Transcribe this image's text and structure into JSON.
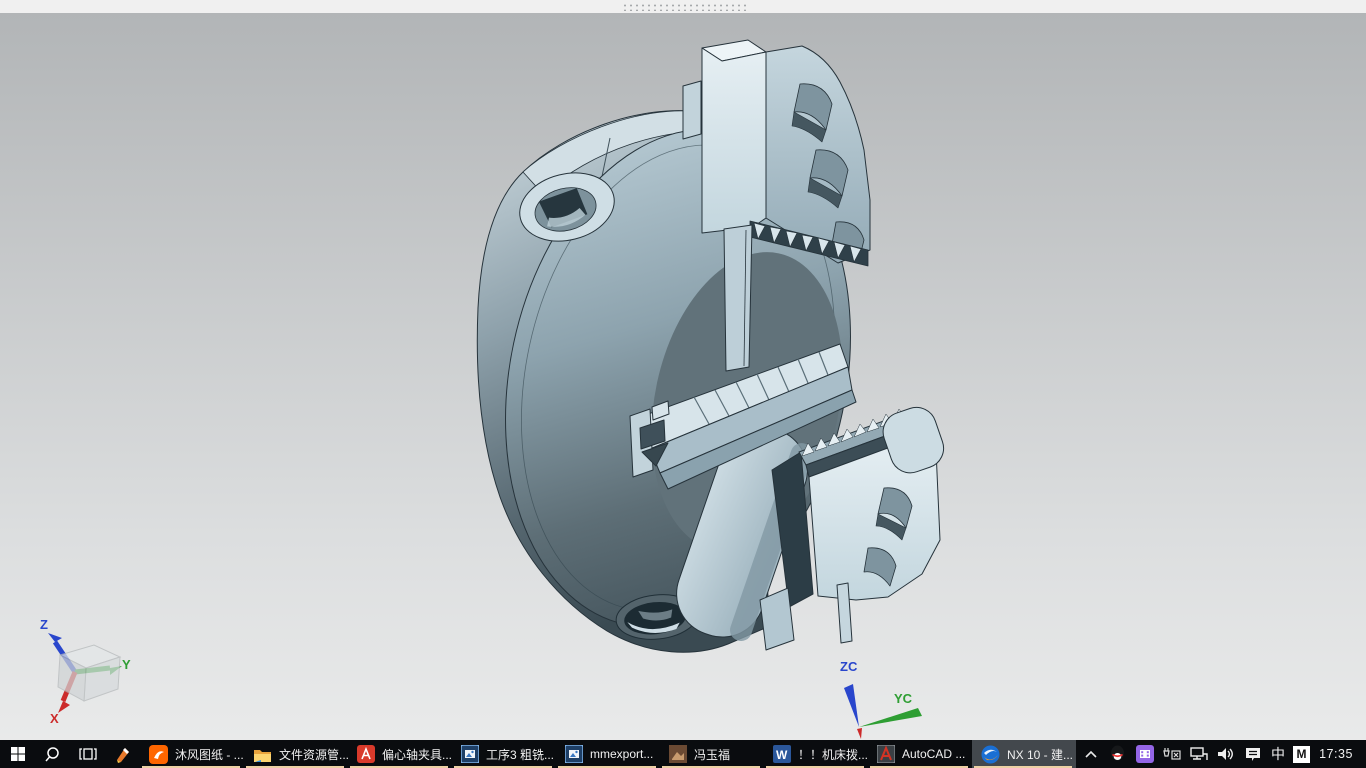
{
  "viewport": {
    "model_description": "3D shaded model of a three-jaw lathe chuck with stepped serrated jaws and two countersunk socket holes",
    "triad": {
      "z_label": "Z",
      "y_label": "Y",
      "x_label": "X"
    },
    "wcs": {
      "zc_label": "ZC",
      "yc_label": "YC"
    }
  },
  "taskbar": {
    "apps": [
      {
        "label": "沐风图纸 - ...",
        "icon": "uc-browser"
      },
      {
        "label": "文件资源管...",
        "icon": "file-explorer"
      },
      {
        "label": "偏心轴夹具...",
        "icon": "pdf-document"
      },
      {
        "label": "工序3 粗铣...",
        "icon": "image-viewer"
      },
      {
        "label": "mmexport...",
        "icon": "image-viewer"
      },
      {
        "label": "冯玉福",
        "icon": "photo"
      },
      {
        "label": "！！机床拨...",
        "icon": "word-document"
      },
      {
        "label": "AutoCAD ...",
        "icon": "autocad"
      },
      {
        "label": "NX 10 - 建...",
        "icon": "nx",
        "active": true
      }
    ],
    "tray": {
      "ime_indicator": "中",
      "ime_badge": "M",
      "clock": "17:35"
    }
  },
  "colors": {
    "taskbar_background": "#0a0c0f",
    "active_app_background": "#43484d",
    "app_underline": "#ecd0a4",
    "top_strip": "#f0f0f0",
    "viewport_gradient_top": "#b2b5b7",
    "viewport_gradient_bottom": "#e9eaea",
    "axis_x": "#cc2b2b",
    "axis_y": "#2e9e33",
    "axis_z": "#2946cc",
    "model_light_face": "#d9e7ed",
    "model_shadow_face": "#3d4d55"
  }
}
